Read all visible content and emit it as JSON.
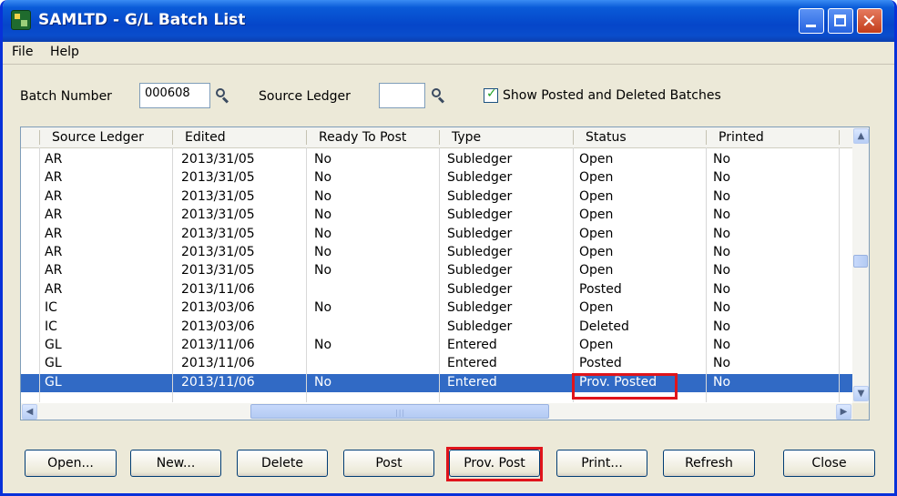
{
  "window": {
    "title": "SAMLTD - G/L Batch List"
  },
  "menu": [
    "File",
    "Help"
  ],
  "filters": {
    "batch_number_label": "Batch Number",
    "batch_number_value": "000608",
    "source_ledger_label": "Source Ledger",
    "source_ledger_value": "",
    "show_posted_label": "Show Posted and Deleted Batches",
    "show_posted_checked": true
  },
  "grid": {
    "columns": [
      "Source Ledger",
      "Edited",
      "Ready To Post",
      "Type",
      "Status",
      "Printed"
    ],
    "rows": [
      [
        "AR",
        "2013/31/05",
        "No",
        "Subledger",
        "Open",
        "No"
      ],
      [
        "AR",
        "2013/31/05",
        "No",
        "Subledger",
        "Open",
        "No"
      ],
      [
        "AR",
        "2013/31/05",
        "No",
        "Subledger",
        "Open",
        "No"
      ],
      [
        "AR",
        "2013/31/05",
        "No",
        "Subledger",
        "Open",
        "No"
      ],
      [
        "AR",
        "2013/31/05",
        "No",
        "Subledger",
        "Open",
        "No"
      ],
      [
        "AR",
        "2013/31/05",
        "No",
        "Subledger",
        "Open",
        "No"
      ],
      [
        "AR",
        "2013/31/05",
        "No",
        "Subledger",
        "Open",
        "No"
      ],
      [
        "AR",
        "2013/11/06",
        "",
        "Subledger",
        "Posted",
        "No"
      ],
      [
        "IC",
        "2013/03/06",
        "No",
        "Subledger",
        "Open",
        "No"
      ],
      [
        "IC",
        "2013/03/06",
        "",
        "Subledger",
        "Deleted",
        "No"
      ],
      [
        "GL",
        "2013/11/06",
        "No",
        "Entered",
        "Open",
        "No"
      ],
      [
        "GL",
        "2013/11/06",
        "",
        "Entered",
        "Posted",
        "No"
      ],
      [
        "GL",
        "2013/11/06",
        "No",
        "Entered",
        "Prov. Posted",
        "No"
      ]
    ],
    "selected_row": 12
  },
  "buttons": [
    {
      "id": "open",
      "label": "Open..."
    },
    {
      "id": "new",
      "label": "New..."
    },
    {
      "id": "delete",
      "label": "Delete"
    },
    {
      "id": "post",
      "label": "Post"
    },
    {
      "id": "prov-post",
      "label": "Prov. Post"
    },
    {
      "id": "print",
      "label": "Print..."
    },
    {
      "id": "refresh",
      "label": "Refresh"
    },
    {
      "id": "close",
      "label": "Close"
    }
  ],
  "colors": {
    "selection": "#316ac5",
    "highlight": "#e0141b",
    "titlebar": "#0546c9"
  },
  "icons": [
    "app-icon",
    "finder-icon",
    "check-icon",
    "scroll-up-arrow-icon",
    "scroll-down-arrow-icon",
    "scroll-left-arrow-icon",
    "scroll-right-arrow-icon"
  ]
}
